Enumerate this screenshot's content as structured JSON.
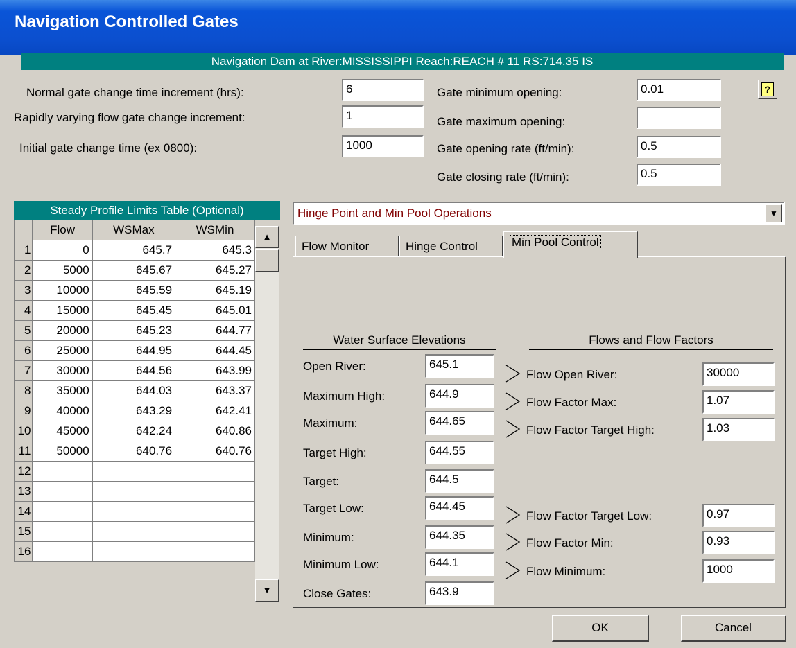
{
  "window": {
    "title": "Navigation Controlled Gates"
  },
  "location": "Navigation Dam at River:MISSISSIPPI  Reach:REACH # 11  RS:714.35   IS",
  "gate_settings": {
    "normal_increment": {
      "label": "Normal gate change time increment (hrs):",
      "value": "6"
    },
    "rapid_increment": {
      "label": "Rapidly varying flow gate change increment:",
      "value": "1"
    },
    "initial_time": {
      "label": "Initial gate change time (ex 0800):",
      "value": "1000"
    },
    "min_opening": {
      "label": "Gate minimum opening:",
      "value": "0.01"
    },
    "max_opening": {
      "label": "Gate maximum opening:",
      "value": ""
    },
    "opening_rate": {
      "label": "Gate opening rate (ft/min):",
      "value": "0.5"
    },
    "closing_rate": {
      "label": "Gate closing rate (ft/min):",
      "value": "0.5"
    }
  },
  "help_button": {
    "label": "?"
  },
  "profile_table": {
    "title": "Steady Profile Limits Table (Optional)",
    "columns": [
      "Flow",
      "WSMax",
      "WSMin"
    ],
    "rows": [
      {
        "n": "1",
        "flow": "0",
        "wsmax": "645.7",
        "wsmin": "645.3"
      },
      {
        "n": "2",
        "flow": "5000",
        "wsmax": "645.67",
        "wsmin": "645.27"
      },
      {
        "n": "3",
        "flow": "10000",
        "wsmax": "645.59",
        "wsmin": "645.19"
      },
      {
        "n": "4",
        "flow": "15000",
        "wsmax": "645.45",
        "wsmin": "645.01"
      },
      {
        "n": "5",
        "flow": "20000",
        "wsmax": "645.23",
        "wsmin": "644.77"
      },
      {
        "n": "6",
        "flow": "25000",
        "wsmax": "644.95",
        "wsmin": "644.45"
      },
      {
        "n": "7",
        "flow": "30000",
        "wsmax": "644.56",
        "wsmin": "643.99"
      },
      {
        "n": "8",
        "flow": "35000",
        "wsmax": "644.03",
        "wsmin": "643.37"
      },
      {
        "n": "9",
        "flow": "40000",
        "wsmax": "643.29",
        "wsmin": "642.41"
      },
      {
        "n": "10",
        "flow": "45000",
        "wsmax": "642.24",
        "wsmin": "640.86"
      },
      {
        "n": "11",
        "flow": "50000",
        "wsmax": "640.76",
        "wsmin": "640.76"
      },
      {
        "n": "12",
        "flow": "",
        "wsmax": "",
        "wsmin": ""
      },
      {
        "n": "13",
        "flow": "",
        "wsmax": "",
        "wsmin": ""
      },
      {
        "n": "14",
        "flow": "",
        "wsmax": "",
        "wsmin": ""
      },
      {
        "n": "15",
        "flow": "",
        "wsmax": "",
        "wsmin": ""
      },
      {
        "n": "16",
        "flow": "",
        "wsmax": "",
        "wsmin": ""
      }
    ]
  },
  "operation_select": {
    "value": "Hinge Point and Min Pool Operations"
  },
  "tabs": [
    "Flow Monitor",
    "Hinge Control",
    "Min Pool Control"
  ],
  "wse": {
    "heading": "Water Surface Elevations",
    "items": [
      {
        "label": "Open River:",
        "value": "645.1"
      },
      {
        "label": "Maximum High:",
        "value": "644.9"
      },
      {
        "label": "Maximum:",
        "value": "644.65"
      },
      {
        "label": "Target High:",
        "value": "644.55"
      },
      {
        "label": "Target:",
        "value": "644.5"
      },
      {
        "label": "Target Low:",
        "value": "644.45"
      },
      {
        "label": "Minimum:",
        "value": "644.35"
      },
      {
        "label": "Minimum Low:",
        "value": "644.1"
      },
      {
        "label": "Close Gates:",
        "value": "643.9"
      }
    ]
  },
  "flows": {
    "heading": "Flows and Flow Factors",
    "items": [
      {
        "label": "Flow Open River:",
        "value": "30000"
      },
      {
        "label": "Flow Factor Max:",
        "value": "1.07"
      },
      {
        "label": "Flow Factor Target High:",
        "value": "1.03"
      },
      {
        "label": "Flow Factor Target Low:",
        "value": "0.97"
      },
      {
        "label": "Flow Factor Min:",
        "value": "0.93"
      },
      {
        "label": "Flow Minimum:",
        "value": "1000"
      }
    ]
  },
  "buttons": {
    "ok": "OK",
    "cancel": "Cancel"
  },
  "colors": {
    "title_bar": "#0a55d8",
    "banner": "#008080",
    "combo_text": "#800000",
    "face": "#d4d0c8"
  }
}
